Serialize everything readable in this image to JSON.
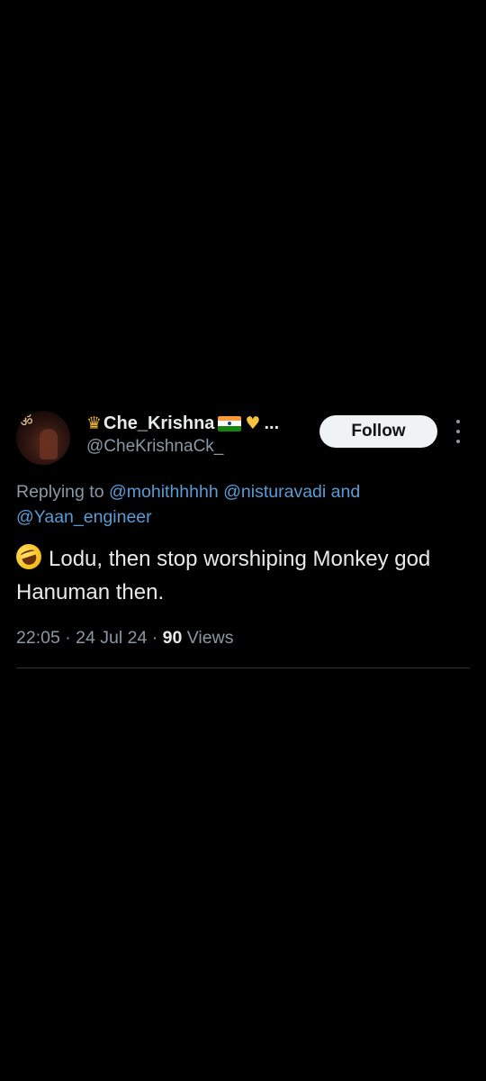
{
  "user": {
    "display_name": "Che_Krishna",
    "name_truncation": "...",
    "handle": "@CheKrishnaCk_",
    "avatar_glyph": "ॐ",
    "icons": [
      "crown-icon",
      "india-flag-icon",
      "yellow-heart-icon"
    ]
  },
  "actions": {
    "follow_label": "Follow"
  },
  "reply": {
    "prefix": "Replying to",
    "mentions": [
      "@mohithhhhh",
      "@nisturavadi",
      "@Yaan_engineer"
    ],
    "conjunction": "and"
  },
  "tweet": {
    "emoji": "rolling-on-floor-laughing-icon",
    "text": "Lodu, then stop worshiping Monkey god Hanuman then."
  },
  "meta": {
    "time": "22:05",
    "separator": "·",
    "date": "24 Jul 24",
    "views_count": "90",
    "views_label": "Views"
  },
  "colors": {
    "background": "#000000",
    "text": "#e7e9ea",
    "secondary": "#8b98a5",
    "link": "#5b9bd5",
    "follow_bg": "#eff3f4"
  }
}
